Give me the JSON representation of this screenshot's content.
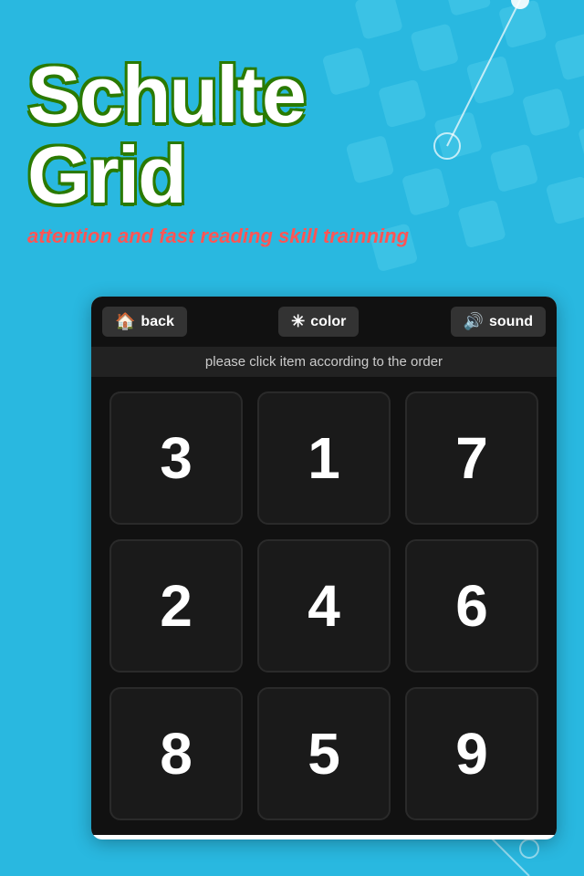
{
  "background": {
    "color": "#29b8e0"
  },
  "title": {
    "line1": "Schulte",
    "line2": "Grid"
  },
  "subtitle": "attention and fast reading skill trainning",
  "toolbar": {
    "back_label": "back",
    "color_label": "color",
    "sound_label": "sound",
    "back_icon": "🏠",
    "color_icon": "✳",
    "sound_icon": "🔊"
  },
  "instruction": "please click item according to the order",
  "grid": {
    "cells": [
      {
        "value": "3",
        "row": 0,
        "col": 0
      },
      {
        "value": "1",
        "row": 0,
        "col": 1
      },
      {
        "value": "7",
        "row": 0,
        "col": 2
      },
      {
        "value": "2",
        "row": 1,
        "col": 0
      },
      {
        "value": "4",
        "row": 1,
        "col": 1
      },
      {
        "value": "6",
        "row": 1,
        "col": 2
      },
      {
        "value": "8",
        "row": 2,
        "col": 0
      },
      {
        "value": "5",
        "row": 2,
        "col": 1
      },
      {
        "value": "9",
        "row": 2,
        "col": 2
      }
    ]
  }
}
